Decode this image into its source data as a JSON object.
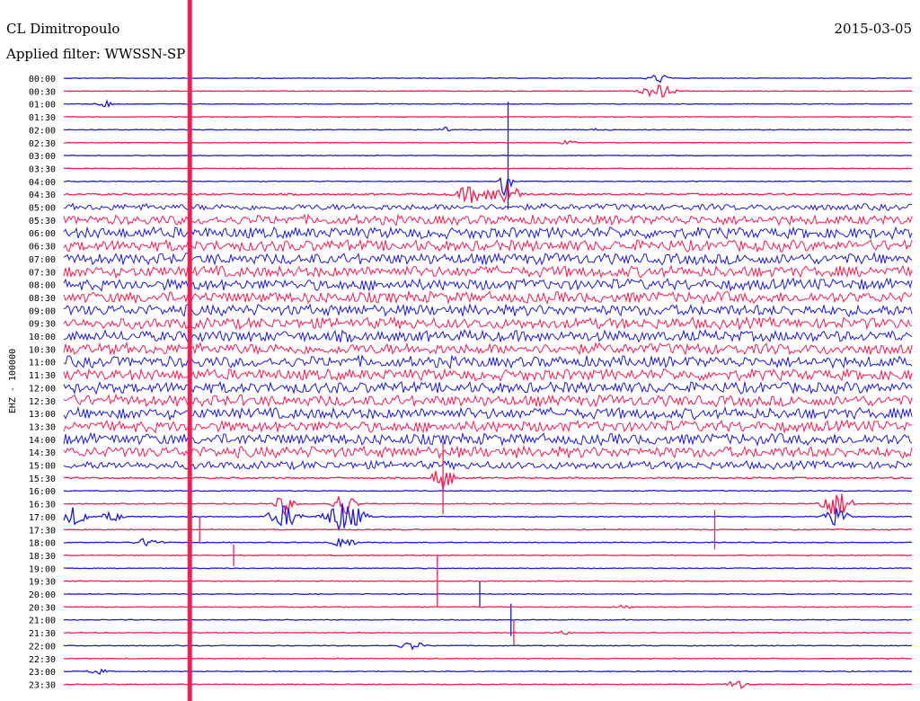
{
  "header": {
    "station": "CL Dimitropoulo",
    "date": "2015-03-05",
    "filter": "Applied filter: WWSSN-SP"
  },
  "chart_data": {
    "type": "helicorder",
    "ylabel": "EHZ - 100000",
    "colors": {
      "even_trace": "#1a1ae6",
      "odd_trace": "#ff1a4d",
      "background": "#ffffff",
      "marker": "#ff1a4d"
    },
    "time_labels": [
      "00:00",
      "00:30",
      "01:00",
      "01:30",
      "02:00",
      "02:30",
      "03:00",
      "03:30",
      "04:00",
      "04:30",
      "05:00",
      "05:30",
      "06:00",
      "06:30",
      "07:00",
      "07:30",
      "08:00",
      "08:30",
      "09:00",
      "09:30",
      "10:00",
      "10:30",
      "11:00",
      "11:30",
      "12:00",
      "12:30",
      "13:00",
      "13:30",
      "14:00",
      "14:30",
      "15:00",
      "15:30",
      "16:00",
      "16:30",
      "17:00",
      "17:30",
      "18:00",
      "18:30",
      "19:00",
      "19:30",
      "20:00",
      "20:30",
      "21:00",
      "21:30",
      "22:00",
      "22:30",
      "23:00",
      "23:30"
    ],
    "trace_noise_level": [
      0.4,
      0.4,
      0.4,
      0.4,
      0.4,
      0.4,
      0.4,
      0.4,
      0.5,
      1.2,
      4,
      6,
      7,
      7,
      7,
      7,
      7,
      7,
      7,
      7,
      7,
      7,
      7,
      7,
      7,
      7,
      7,
      7,
      7,
      7,
      5,
      1,
      0.6,
      0.6,
      0.6,
      0.6,
      0.5,
      0.5,
      0.5,
      0.5,
      0.5,
      0.5,
      0.5,
      0.5,
      0.5,
      0.5,
      0.5,
      0.5
    ],
    "events": [
      {
        "trace": 0,
        "minute": 21.0,
        "amplitude": 5,
        "duration": 0.6
      },
      {
        "trace": 1,
        "minute": 21.0,
        "amplitude": 8,
        "duration": 0.8
      },
      {
        "trace": 2,
        "minute": 1.5,
        "amplitude": 4,
        "duration": 0.5
      },
      {
        "trace": 4,
        "minute": 13.5,
        "amplitude": 3,
        "duration": 0.4
      },
      {
        "trace": 4,
        "minute": 19.0,
        "amplitude": 3,
        "duration": 0.4
      },
      {
        "trace": 5,
        "minute": 17.8,
        "amplitude": 3,
        "duration": 0.4
      },
      {
        "trace": 8,
        "minute": 15.6,
        "amplitude": 18,
        "duration": 0.3
      },
      {
        "trace": 9,
        "minute": 14.4,
        "amplitude": 10,
        "duration": 0.8
      },
      {
        "trace": 9,
        "minute": 15.6,
        "amplitude": 12,
        "duration": 0.8
      },
      {
        "trace": 31,
        "minute": 13.4,
        "amplitude": 16,
        "duration": 0.5
      },
      {
        "trace": 33,
        "minute": 7.8,
        "amplitude": 12,
        "duration": 0.5
      },
      {
        "trace": 33,
        "minute": 9.9,
        "amplitude": 14,
        "duration": 0.6
      },
      {
        "trace": 33,
        "minute": 27.3,
        "amplitude": 16,
        "duration": 0.8
      },
      {
        "trace": 34,
        "minute": 0.4,
        "amplitude": 12,
        "duration": 0.6
      },
      {
        "trace": 34,
        "minute": 1.7,
        "amplitude": 6,
        "duration": 0.5
      },
      {
        "trace": 34,
        "minute": 7.8,
        "amplitude": 13,
        "duration": 0.8
      },
      {
        "trace": 34,
        "minute": 9.9,
        "amplitude": 18,
        "duration": 1.0
      },
      {
        "trace": 34,
        "minute": 27.3,
        "amplitude": 10,
        "duration": 0.6
      },
      {
        "trace": 36,
        "minute": 3.0,
        "amplitude": 6,
        "duration": 0.6
      },
      {
        "trace": 36,
        "minute": 9.9,
        "amplitude": 8,
        "duration": 0.6
      },
      {
        "trace": 41,
        "minute": 19.8,
        "amplitude": 3,
        "duration": 0.4
      },
      {
        "trace": 43,
        "minute": 17.6,
        "amplitude": 3,
        "duration": 0.4
      },
      {
        "trace": 44,
        "minute": 12.3,
        "amplitude": 5,
        "duration": 0.6
      },
      {
        "trace": 46,
        "minute": 1.2,
        "amplitude": 3,
        "duration": 0.5
      },
      {
        "trace": 47,
        "minute": 23.8,
        "amplitude": 6,
        "duration": 0.5
      }
    ],
    "spikes": [
      {
        "trace": 6,
        "minute": 15.7,
        "amplitude": 60
      },
      {
        "trace": 31,
        "minute": 13.4,
        "amplitude": 40
      },
      {
        "trace": 39,
        "minute": 13.2,
        "amplitude": 28
      },
      {
        "trace": 42,
        "minute": 15.8,
        "amplitude": 18
      },
      {
        "trace": 35,
        "minute": 23.0,
        "amplitude": 22
      },
      {
        "trace": 35,
        "minute": 4.8,
        "amplitude": 14
      },
      {
        "trace": 37,
        "minute": 6.0,
        "amplitude": 12
      },
      {
        "trace": 40,
        "minute": 14.7,
        "amplitude": 14
      },
      {
        "trace": 43,
        "minute": 15.9,
        "amplitude": 14
      }
    ],
    "marker_minute": 4.45
  }
}
